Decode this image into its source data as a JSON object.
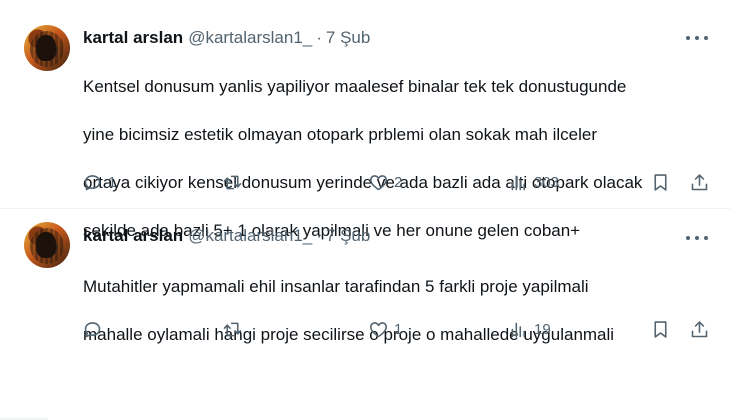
{
  "tweets": [
    {
      "author": {
        "name": "kartal arslan",
        "handle": "@kartalarslan1_"
      },
      "separator": "·",
      "time": "7 Şub",
      "text_lines": [
        "Kentsel donusum yanlis yapiliyor maalesef binalar tek tek donustugunde",
        "yine bicimsiz estetik olmayan otopark prblemi olan sokak mah ilceler",
        "ortaya cikiyor kensel donusum yerinde ve ada bazli ada alti otopark olacak",
        "sekilde ada bazli 5+ 1 olarak yapilmali ve her onune gelen coban+"
      ],
      "stats": {
        "replies": "1",
        "retweets": "",
        "likes": "2",
        "views": "303"
      }
    },
    {
      "author": {
        "name": "kartal arslan",
        "handle": "@kartalarslan1_"
      },
      "separator": "·",
      "time": "7 Şub",
      "text_lines": [
        "Mutahitler yapmamali ehil  insanlar tarafindan  5 farkli proje  yapilmali",
        "mahalle oylamali hangi proje secilirse o proje o mahallede uygulanmali"
      ],
      "stats": {
        "replies": "",
        "retweets": "",
        "likes": "1",
        "views": "19"
      }
    }
  ],
  "icons": {
    "reply": "reply-icon",
    "retweet": "retweet-icon",
    "like": "heart-icon",
    "views": "views-icon",
    "bookmark": "bookmark-icon",
    "share": "share-icon",
    "more": "more-dots-icon"
  },
  "colors": {
    "text": "#0f1419",
    "secondary": "#536471",
    "divider": "#eff3f4"
  }
}
